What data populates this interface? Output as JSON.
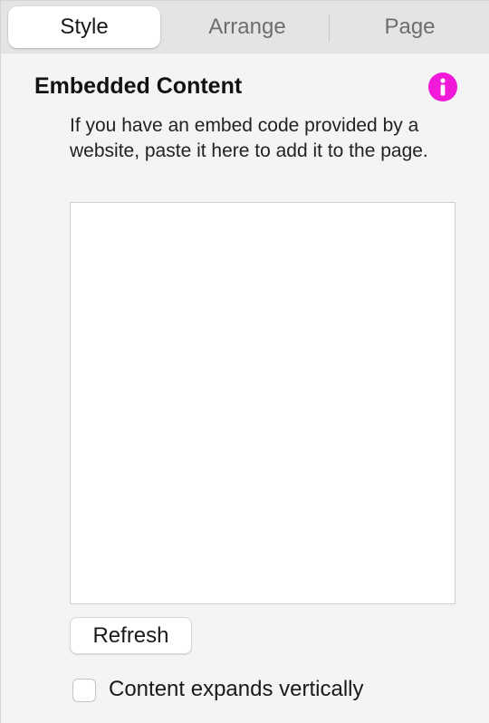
{
  "tabs": [
    {
      "label": "Style",
      "active": true
    },
    {
      "label": "Arrange",
      "active": false
    },
    {
      "label": "Page",
      "active": false
    }
  ],
  "section": {
    "title": "Embedded Content",
    "info_icon": "info-icon",
    "info_color": "#f01ad8",
    "description": "If you have an embed code provided by a website, paste it here to add it to the page."
  },
  "embed": {
    "value": "",
    "placeholder": ""
  },
  "refresh_button": {
    "label": "Refresh"
  },
  "expand_option": {
    "label": "Content expands vertically",
    "checked": false
  }
}
